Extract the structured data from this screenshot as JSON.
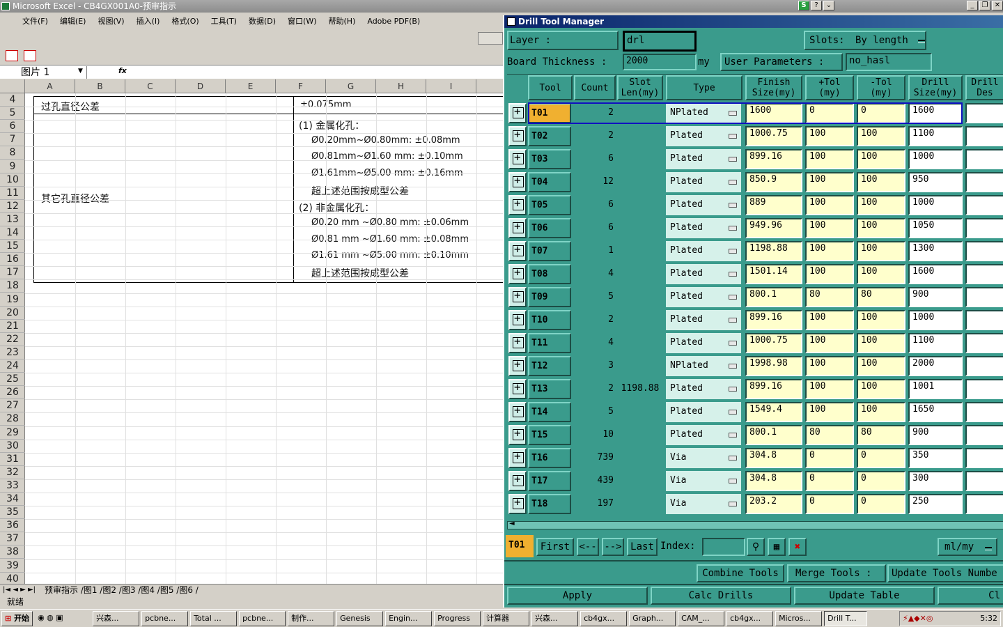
{
  "excel": {
    "title": "Microsoft Excel - CB4GX001A0-预审指示",
    "menu": [
      "文件(F)",
      "编辑(E)",
      "视图(V)",
      "插入(I)",
      "格式(O)",
      "工具(T)",
      "数据(D)",
      "窗口(W)",
      "帮助(H)",
      "Adobe PDF(B)"
    ],
    "name_box": "图片 1",
    "fx": "fx",
    "columns": [
      "A",
      "B",
      "C",
      "D",
      "E",
      "F",
      "G",
      "H",
      "I"
    ],
    "rows": [
      "4",
      "5",
      "6",
      "7",
      "8",
      "9",
      "10",
      "11",
      "12",
      "13",
      "14",
      "15",
      "16",
      "17",
      "18",
      "19",
      "20",
      "21",
      "22",
      "23",
      "24",
      "25",
      "26",
      "27",
      "28",
      "29",
      "30",
      "31",
      "32",
      "33",
      "34",
      "35",
      "36",
      "37",
      "38",
      "39",
      "40"
    ],
    "doc": {
      "via_label": "过孔直径公差",
      "via_value": "±0.075mm",
      "other_label": "其它孔直径公差",
      "lines": [
        "(1)  金属化孔：",
        "Ø0.20mm~Ø0.80mm:  ±0.08mm",
        "Ø0.81mm~Ø1.60 mm:  ±0.10mm",
        "Ø1.61mm~Ø5.00 mm:  ±0.16mm",
        "超上述范围按成型公差",
        "(2)  非金属化孔：",
        "Ø0.20 mm ~Ø0.80 mm:  ±0.06mm",
        "Ø0.81 mm ~Ø1.60 mm:  ±0.08mm",
        "Ø1.61 mm ~Ø5.00 mm:  ±0.10mm",
        "超上述范围按成型公差"
      ]
    },
    "sheet_tabs": "预审指示 /图1 /图2 /图3 /图4 /图5 /图6 /",
    "status": "就绪"
  },
  "dtm": {
    "title": "Drill Tool Manager",
    "layer_label": "Layer          :",
    "layer_value": "drl",
    "slots_label": "Slots:",
    "slots_value": "By length",
    "thickness_label": "Board Thickness :",
    "thickness_value": "2000",
    "thickness_unit": "my",
    "user_params_label": "User Parameters :",
    "user_params_value": "no_hasl",
    "headers": {
      "tool": "Tool",
      "count": "Count",
      "slot": "Slot Len(my)",
      "type": "Type",
      "finish": "Finish Size(my)",
      "ptol": "+Tol (my)",
      "ntol": "-Tol (my)",
      "drill": "Drill Size(my)",
      "desc": "Drill Des"
    },
    "rows": [
      {
        "tool": "T01",
        "count": "2",
        "slot": "",
        "type": "NPlated",
        "finish": "1600",
        "ptol": "0",
        "ntol": "0",
        "drill": "1600"
      },
      {
        "tool": "T02",
        "count": "2",
        "slot": "",
        "type": "Plated",
        "finish": "1000.75",
        "ptol": "100",
        "ntol": "100",
        "drill": "1100"
      },
      {
        "tool": "T03",
        "count": "6",
        "slot": "",
        "type": "Plated",
        "finish": "899.16",
        "ptol": "100",
        "ntol": "100",
        "drill": "1000"
      },
      {
        "tool": "T04",
        "count": "12",
        "slot": "",
        "type": "Plated",
        "finish": "850.9",
        "ptol": "100",
        "ntol": "100",
        "drill": "950"
      },
      {
        "tool": "T05",
        "count": "6",
        "slot": "",
        "type": "Plated",
        "finish": "889",
        "ptol": "100",
        "ntol": "100",
        "drill": "1000"
      },
      {
        "tool": "T06",
        "count": "6",
        "slot": "",
        "type": "Plated",
        "finish": "949.96",
        "ptol": "100",
        "ntol": "100",
        "drill": "1050"
      },
      {
        "tool": "T07",
        "count": "1",
        "slot": "",
        "type": "Plated",
        "finish": "1198.88",
        "ptol": "100",
        "ntol": "100",
        "drill": "1300"
      },
      {
        "tool": "T08",
        "count": "4",
        "slot": "",
        "type": "Plated",
        "finish": "1501.14",
        "ptol": "100",
        "ntol": "100",
        "drill": "1600"
      },
      {
        "tool": "T09",
        "count": "5",
        "slot": "",
        "type": "Plated",
        "finish": "800.1",
        "ptol": "80",
        "ntol": "80",
        "drill": "900"
      },
      {
        "tool": "T10",
        "count": "2",
        "slot": "",
        "type": "Plated",
        "finish": "899.16",
        "ptol": "100",
        "ntol": "100",
        "drill": "1000"
      },
      {
        "tool": "T11",
        "count": "4",
        "slot": "",
        "type": "Plated",
        "finish": "1000.75",
        "ptol": "100",
        "ntol": "100",
        "drill": "1100"
      },
      {
        "tool": "T12",
        "count": "3",
        "slot": "",
        "type": "NPlated",
        "finish": "1998.98",
        "ptol": "100",
        "ntol": "100",
        "drill": "2000"
      },
      {
        "tool": "T13",
        "count": "2",
        "slot": "1198.88",
        "type": "Plated",
        "finish": "899.16",
        "ptol": "100",
        "ntol": "100",
        "drill": "1001"
      },
      {
        "tool": "T14",
        "count": "5",
        "slot": "",
        "type": "Plated",
        "finish": "1549.4",
        "ptol": "100",
        "ntol": "100",
        "drill": "1650"
      },
      {
        "tool": "T15",
        "count": "10",
        "slot": "",
        "type": "Plated",
        "finish": "800.1",
        "ptol": "80",
        "ntol": "80",
        "drill": "900"
      },
      {
        "tool": "T16",
        "count": "739",
        "slot": "",
        "type": "Via",
        "finish": "304.8",
        "ptol": "0",
        "ntol": "0",
        "drill": "350"
      },
      {
        "tool": "T17",
        "count": "439",
        "slot": "",
        "type": "Via",
        "finish": "304.8",
        "ptol": "0",
        "ntol": "0",
        "drill": "300"
      },
      {
        "tool": "T18",
        "count": "197",
        "slot": "",
        "type": "Via",
        "finish": "203.2",
        "ptol": "0",
        "ntol": "0",
        "drill": "250"
      }
    ],
    "nav": {
      "current": "T01",
      "first": "First",
      "prev": "<--",
      "next": "-->",
      "last": "Last",
      "index_label": "Index:",
      "units": "ml/my"
    },
    "actions": {
      "combine": "Combine Tools",
      "merge": "Merge Tools :",
      "update_numbers": "Update Tools Numbe",
      "apply": "Apply",
      "calc": "Calc Drills",
      "update_table": "Update Table",
      "close": "Cl"
    },
    "colors": {
      "bg": "#3a9b8c",
      "field": "#ffffcc",
      "title": "#0a246a"
    }
  },
  "taskbar": {
    "start": "开始",
    "items": [
      "兴森...",
      "pcbne...",
      "Total ...",
      "pcbne...",
      "制作...",
      "Genesis",
      "Engin...",
      "Progress",
      "计算器",
      "兴森...",
      "cb4gx...",
      "Graph...",
      "CAM_...",
      "cb4gx...",
      "Micros...",
      "Drill T..."
    ],
    "clock": "5:32"
  }
}
